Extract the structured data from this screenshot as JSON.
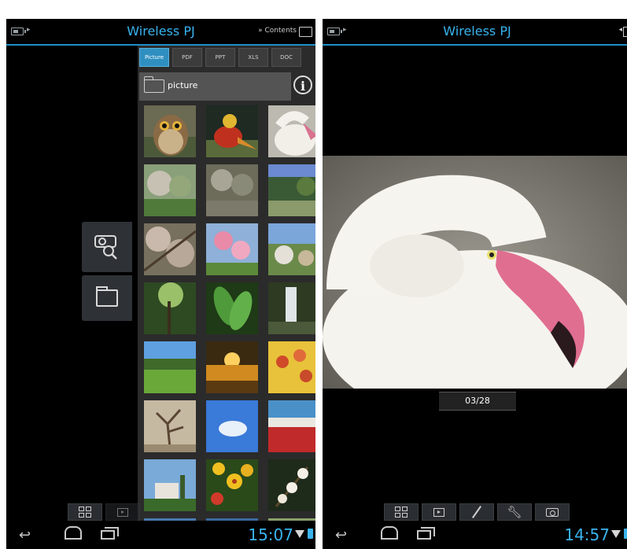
{
  "left_screen": {
    "title": "Wireless PJ",
    "contents_link": "» Contents",
    "tabs": [
      {
        "label": "Picture",
        "active": true
      },
      {
        "label": "PDF",
        "active": false
      },
      {
        "label": "PPT",
        "active": false
      },
      {
        "label": "XLS",
        "active": false
      },
      {
        "label": "DOC",
        "active": false
      }
    ],
    "folder_name": "picture",
    "clock": "15:07"
  },
  "right_screen": {
    "title": "Wireless PJ",
    "page_counter": "03/28",
    "clock": "14:57"
  },
  "colors": {
    "accent": "#39b4ef",
    "active_tab": "#2f8fc0",
    "panel_bg": "#2b2b2b"
  },
  "thumbnails": [
    "owl",
    "pheasant",
    "flamingo",
    "garden-trees",
    "waterfall-rocks",
    "garden-stream",
    "cherry-blossom-branches",
    "pink-blossoms",
    "blossom-valley",
    "forest-trees",
    "green-leaves",
    "waterfall",
    "meadow",
    "sunset-clouds",
    "yellow-blossoms",
    "bare-tree",
    "blue-sky",
    "red-flowers",
    "villa",
    "yellow-flowers",
    "white-blossoms"
  ]
}
